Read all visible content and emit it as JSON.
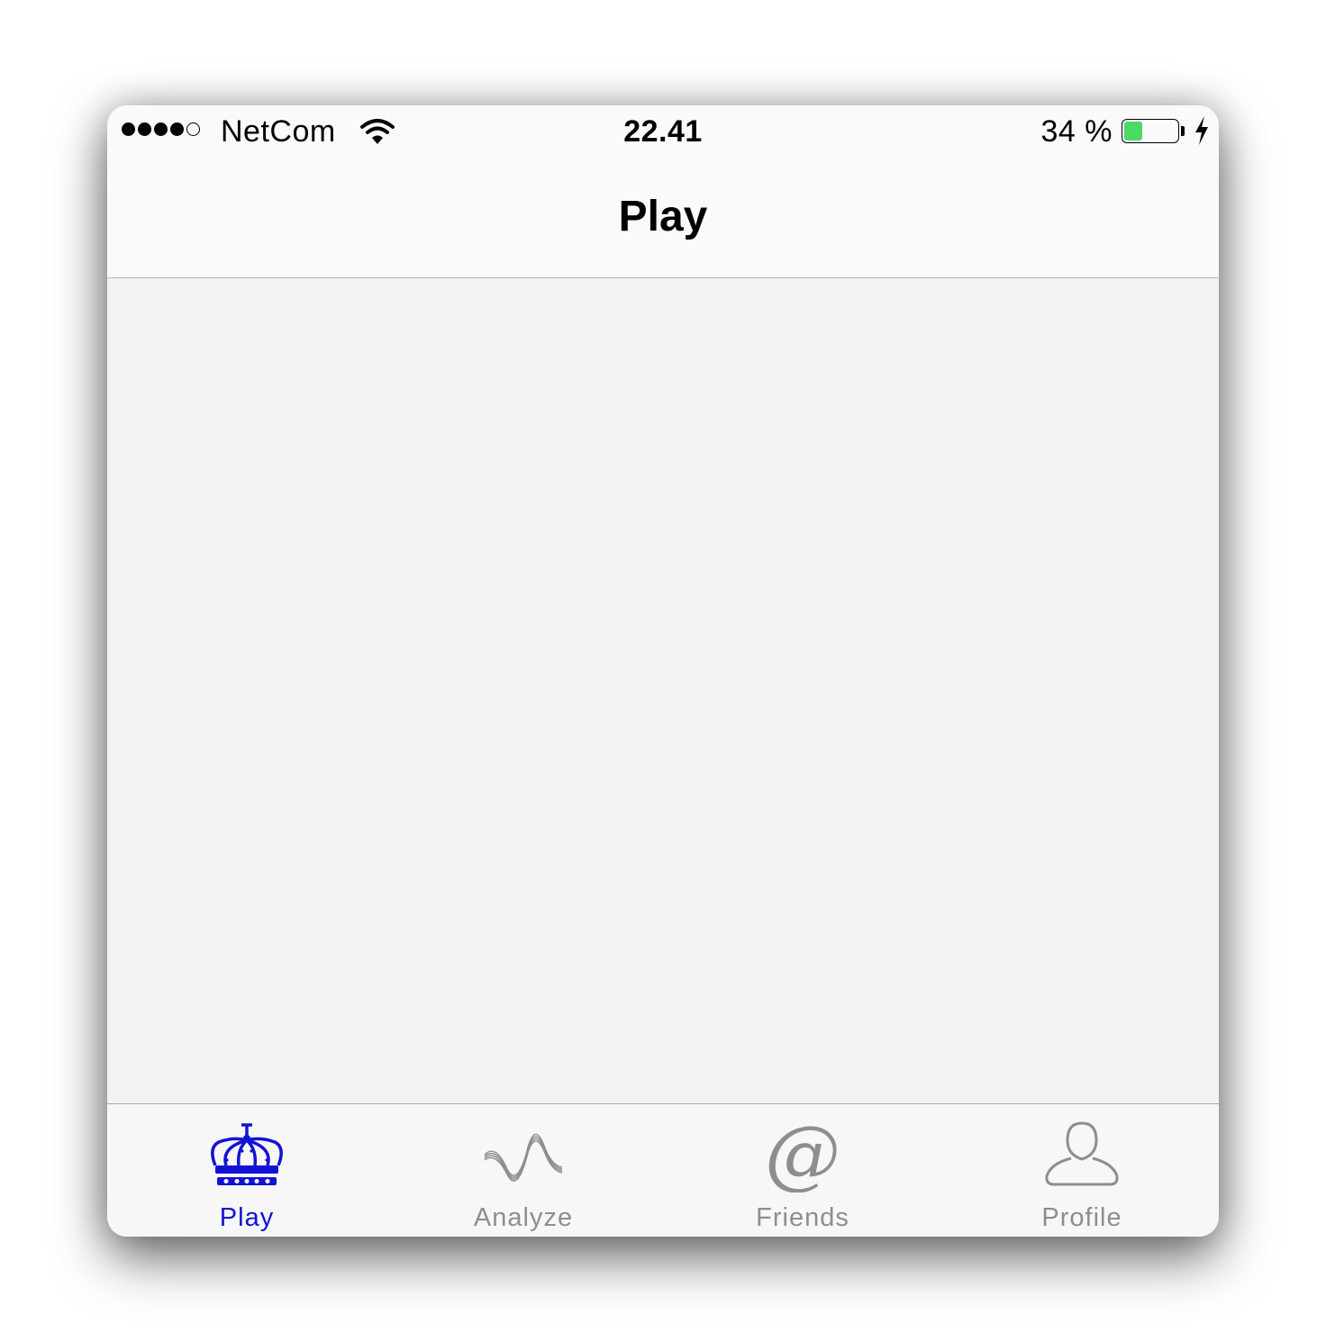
{
  "status_bar": {
    "carrier": "NetCom",
    "signal_bars_filled": 4,
    "signal_bars_total": 5,
    "time": "22.41",
    "battery_percent_label": "34 %",
    "battery_level": 0.34,
    "charging": true,
    "battery_fill_color": "#4cd964"
  },
  "nav": {
    "title": "Play"
  },
  "tab_bar": {
    "active_color": "#1212d6",
    "inactive_color": "#8e8e8e",
    "tabs": [
      {
        "label": "Play",
        "icon": "crown-icon",
        "active": true
      },
      {
        "label": "Analyze",
        "icon": "wave-icon",
        "active": false
      },
      {
        "label": "Friends",
        "icon": "at-sign-icon",
        "active": false
      },
      {
        "label": "Profile",
        "icon": "person-icon",
        "active": false
      }
    ]
  }
}
